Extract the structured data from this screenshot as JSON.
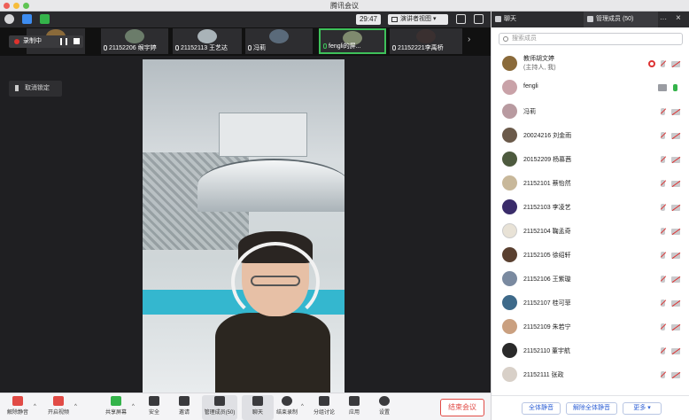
{
  "window": {
    "title": "腾讯会议"
  },
  "toolbar": {
    "timer": "29:47",
    "view_label": "演讲者视图"
  },
  "colors": {
    "close": "#ee5f57",
    "minimize": "#f6bd3b",
    "maximize": "#5fc454",
    "end_meeting": "#e14b46",
    "accent_blue": "#2f61d6",
    "signal_green": "#34b34a"
  },
  "strip": {
    "thumbs": [
      {
        "name": ""
      },
      {
        "name": "21152206 缑宇婷"
      },
      {
        "name": "21152113 王艺达"
      },
      {
        "name": "冯莉"
      },
      {
        "name": "fengli的屏..."
      },
      {
        "name": "21152221李禹桥"
      }
    ]
  },
  "stage": {
    "recording_label": "录制中",
    "unlock_label": "取消锁定"
  },
  "bottombar": {
    "items": [
      {
        "label": "解除静音",
        "icon": "mic-muted-icon"
      },
      {
        "label": "开启视频",
        "icon": "camera-off-icon"
      },
      {
        "label": "共享屏幕",
        "icon": "screen-share-icon"
      },
      {
        "label": "安全",
        "icon": "shield-icon"
      },
      {
        "label": "邀请",
        "icon": "invite-icon"
      },
      {
        "label": "管理成员(50)",
        "icon": "members-icon"
      },
      {
        "label": "聊天",
        "icon": "chat-icon"
      },
      {
        "label": "结束录制",
        "icon": "stop-record-icon"
      },
      {
        "label": "分组讨论",
        "icon": "breakout-icon"
      },
      {
        "label": "应用",
        "icon": "apps-icon"
      },
      {
        "label": "设置",
        "icon": "gear-icon"
      }
    ],
    "end_label": "结束会议"
  },
  "panel": {
    "tab_chat": "聊天",
    "tab_members": "管理成员 (50)",
    "more": "···",
    "close": "×",
    "search_placeholder": "搜索成员",
    "members": [
      {
        "name": "教师胡文婷",
        "sub": "(主持人, 我)",
        "color": "#8a6a3a"
      },
      {
        "name": "fengli",
        "sub": "",
        "color": "#c9a2a8"
      },
      {
        "name": "冯莉",
        "sub": "",
        "color": "#b89aa0"
      },
      {
        "name": "20024216 刘金雨",
        "sub": "",
        "color": "#6b5a4a"
      },
      {
        "name": "20152209 杨慕茜",
        "sub": "",
        "color": "#4d5a3e"
      },
      {
        "name": "21152101 蔡怡然",
        "sub": "",
        "color": "#c8b89a"
      },
      {
        "name": "21152103 李凌艺",
        "sub": "",
        "color": "#3a2c6a"
      },
      {
        "name": "21152104 鞠孟奇",
        "sub": "",
        "color": "#e8e2d6"
      },
      {
        "name": "21152105 徐绍轩",
        "sub": "",
        "color": "#5a4030"
      },
      {
        "name": "21152106 王紫璇",
        "sub": "",
        "color": "#7a8aa0"
      },
      {
        "name": "21152107 桂可菲",
        "sub": "",
        "color": "#3e6a8a"
      },
      {
        "name": "21152109 朱若宁",
        "sub": "",
        "color": "#caa080"
      },
      {
        "name": "21152110 董宇航",
        "sub": "",
        "color": "#2a2a2a"
      },
      {
        "name": "21152111 张政",
        "sub": "",
        "color": "#d8d0c8"
      }
    ],
    "btn_mute_all": "全体静音",
    "btn_unmute_all": "解除全体静音",
    "btn_more": "更多 ▾"
  }
}
